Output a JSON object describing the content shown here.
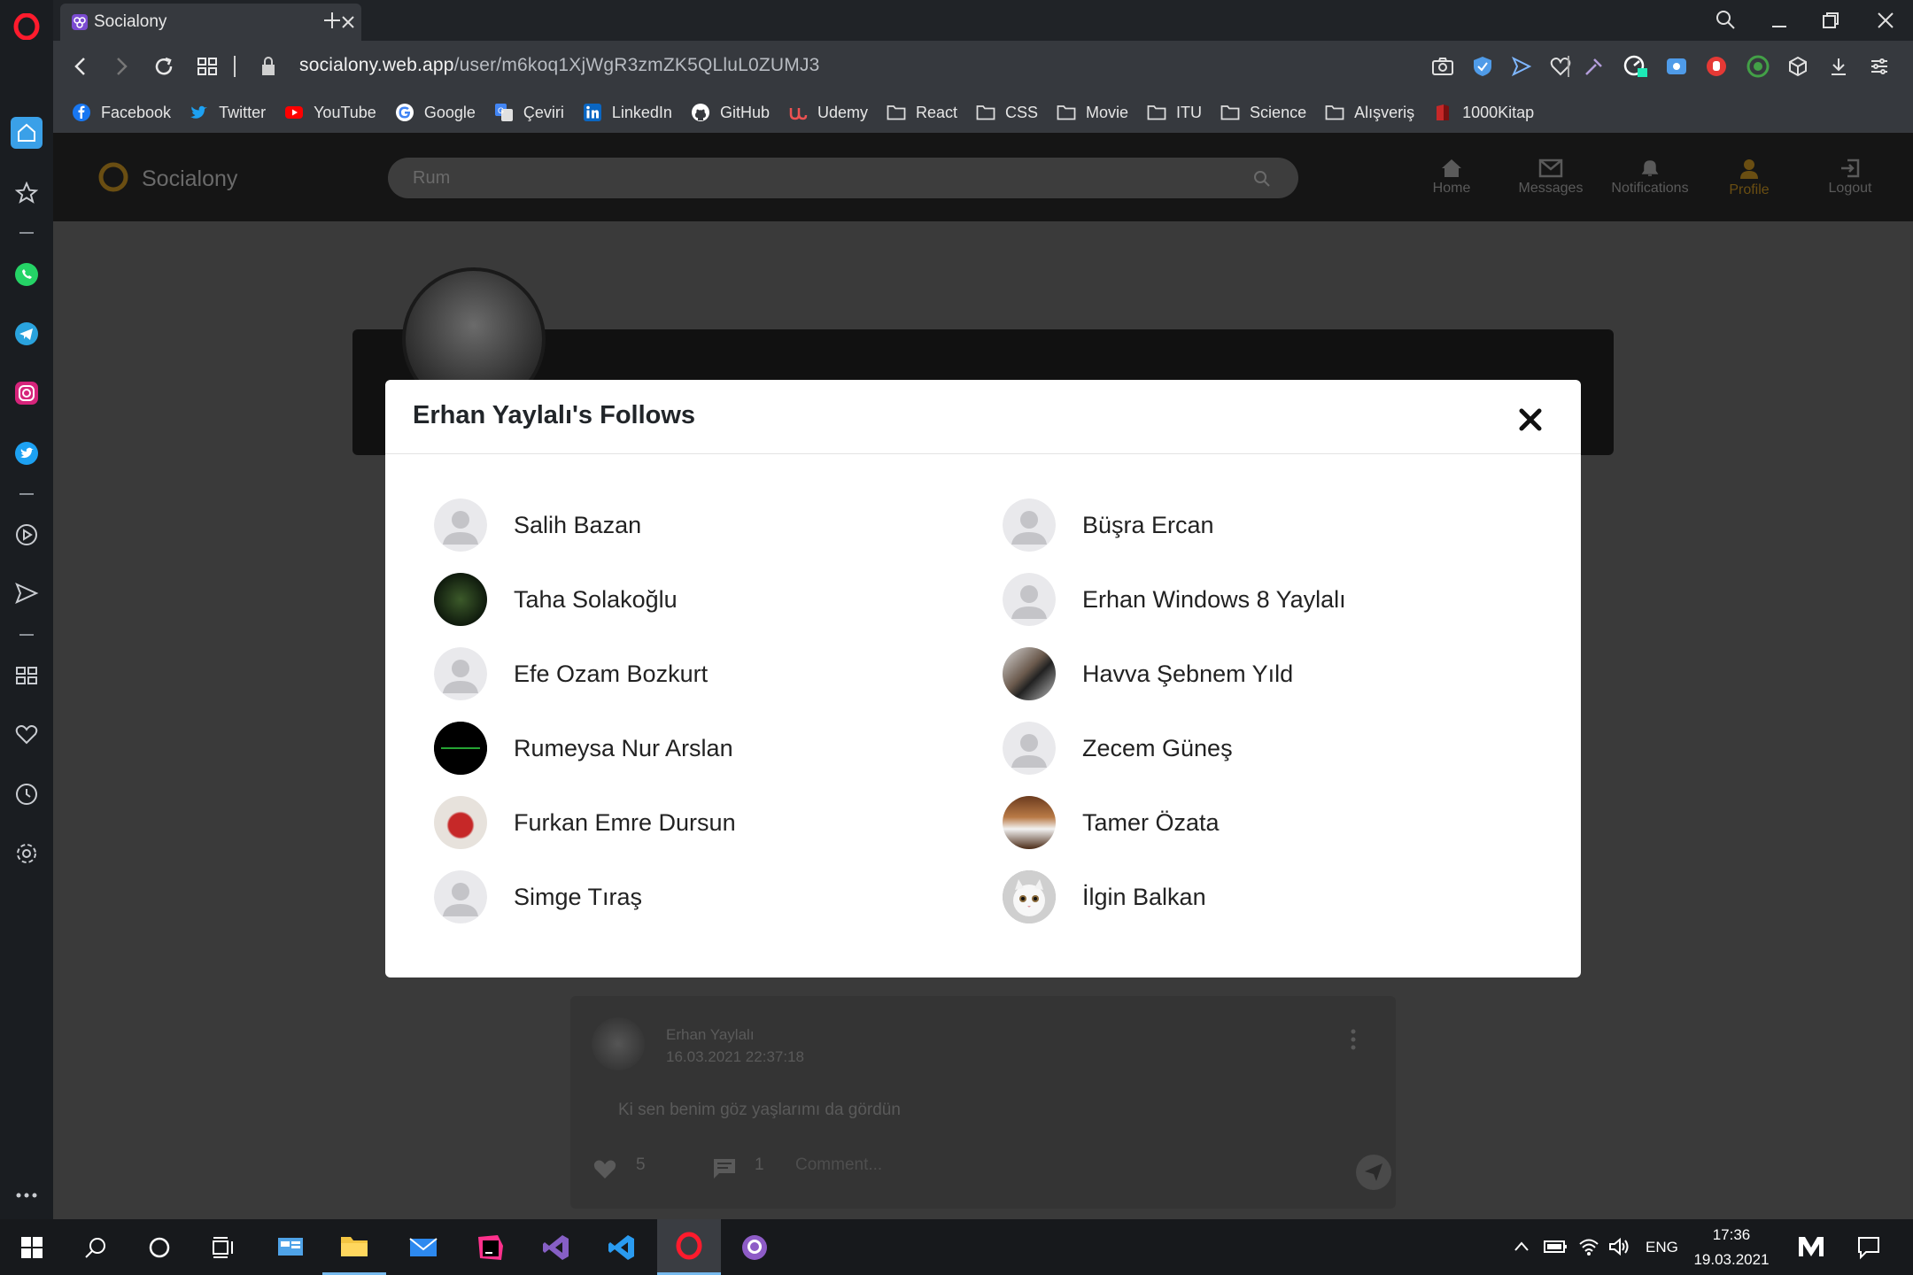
{
  "browser": {
    "tab_title": "Socialony",
    "url_domain": "socialony.web.app",
    "url_path": "/user/m6koq1XjWgR3zmZK5QLluL0ZUMJ3"
  },
  "bookmarks": [
    {
      "label": "Facebook",
      "icon": "facebook-icon",
      "color": "#1877f2"
    },
    {
      "label": "Twitter",
      "icon": "twitter-icon",
      "color": "#1da1f2"
    },
    {
      "label": "YouTube",
      "icon": "youtube-icon",
      "color": "#ff0000"
    },
    {
      "label": "Google",
      "icon": "google-icon",
      "color": "#4285f4"
    },
    {
      "label": "Çeviri",
      "icon": "translate-icon",
      "color": "#4285f4"
    },
    {
      "label": "LinkedIn",
      "icon": "linkedin-icon",
      "color": "#0a66c2"
    },
    {
      "label": "GitHub",
      "icon": "github-icon",
      "color": "#ffffff"
    },
    {
      "label": "Udemy",
      "icon": "udemy-icon",
      "color": "#ec5252"
    },
    {
      "label": "React",
      "icon": "folder-icon",
      "color": "#dddddd"
    },
    {
      "label": "CSS",
      "icon": "folder-icon",
      "color": "#dddddd"
    },
    {
      "label": "Movie",
      "icon": "folder-icon",
      "color": "#dddddd"
    },
    {
      "label": "ITU",
      "icon": "folder-icon",
      "color": "#dddddd"
    },
    {
      "label": "Science",
      "icon": "folder-icon",
      "color": "#dddddd"
    },
    {
      "label": "Alışveriş",
      "icon": "folder-icon",
      "color": "#dddddd"
    },
    {
      "label": "1000Kitap",
      "icon": "kitap-icon",
      "color": "#c62828"
    }
  ],
  "app": {
    "logo": "Socialony",
    "search_value": "Rum",
    "nav": {
      "home": "Home",
      "messages": "Messages",
      "notifications": "Notifications",
      "profile": "Profile",
      "logout": "Logout"
    },
    "post": {
      "author": "Erhan Yaylalı",
      "time": "16.03.2021 22:37:18",
      "text": "Ki sen benim göz yaşlarımı da gördün",
      "likes": "5",
      "comments": "1",
      "comment_placeholder": "Comment..."
    }
  },
  "modal": {
    "title": "Erhan Yaylalı's Follows",
    "follows": [
      {
        "name": "Salih Bazan",
        "avatar": "default"
      },
      {
        "name": "Büşra Ercan",
        "avatar": "default"
      },
      {
        "name": "Taha Solakoğlu",
        "avatar": "photo"
      },
      {
        "name": "Erhan Windows 8 Yaylalı",
        "avatar": "default"
      },
      {
        "name": "Efe Ozam Bozkurt",
        "avatar": "default"
      },
      {
        "name": "Havva Şebnem Yıld",
        "avatar": "photo"
      },
      {
        "name": "Rumeysa Nur Arslan",
        "avatar": "photo"
      },
      {
        "name": "Zecem Güneş",
        "avatar": "default"
      },
      {
        "name": "Furkan Emre Dursun",
        "avatar": "photo"
      },
      {
        "name": "Tamer Özata",
        "avatar": "photo"
      },
      {
        "name": "Simge Tıraş",
        "avatar": "default"
      },
      {
        "name": "İlgin Balkan",
        "avatar": "photo"
      }
    ]
  },
  "taskbar": {
    "language": "ENG",
    "time": "17:36",
    "date": "19.03.2021"
  },
  "colors": {
    "opera_red": "#ff1b2d",
    "modal_bg": "#ffffff",
    "overlay": "#3a3a3a",
    "accent_profile": "#8a6a1c"
  }
}
